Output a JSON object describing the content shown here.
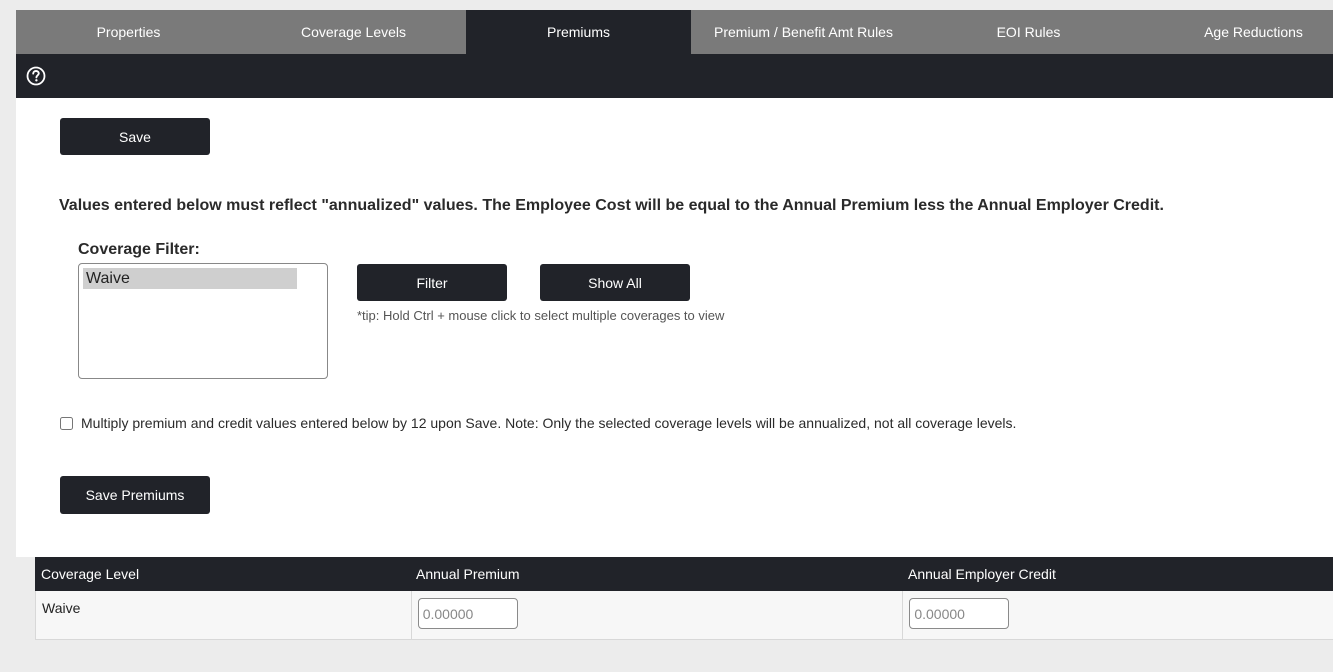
{
  "tabs": [
    {
      "label": "Properties",
      "active": false
    },
    {
      "label": "Coverage Levels",
      "active": false
    },
    {
      "label": "Premiums",
      "active": true
    },
    {
      "label": "Premium / Benefit Amt Rules",
      "active": false
    },
    {
      "label": "EOI Rules",
      "active": false
    },
    {
      "label": "Age Reductions",
      "active": false
    }
  ],
  "toolbar": {
    "help_icon": "help-circle-icon"
  },
  "form": {
    "save_label": "Save",
    "note": "Values entered below must reflect \"annualized\" values. The Employee Cost will be equal to the Annual Premium less the Annual Employer Credit.",
    "coverage_filter_label": "Coverage Filter:",
    "coverage_options": [
      "Waive"
    ],
    "filter_label": "Filter",
    "show_all_label": "Show All",
    "tip": "*tip: Hold Ctrl + mouse click to select multiple coverages to view",
    "annualize_checked": false,
    "annualize_label": "Multiply premium and credit values entered below by 12 upon Save. Note: Only the selected coverage levels will be annualized, not all coverage levels.",
    "save_premiums_label": "Save Premiums"
  },
  "table": {
    "headers": [
      "Coverage Level",
      "Annual Premium",
      "Annual Employer Credit"
    ],
    "rows": [
      {
        "coverage_level": "Waive",
        "premium_placeholder": "0.00000",
        "credit_placeholder": "0.00000"
      }
    ]
  },
  "colors": {
    "tab_bar": "#7a7a7a",
    "dark": "#212329",
    "panel": "#ffffff",
    "page": "#ececec"
  }
}
